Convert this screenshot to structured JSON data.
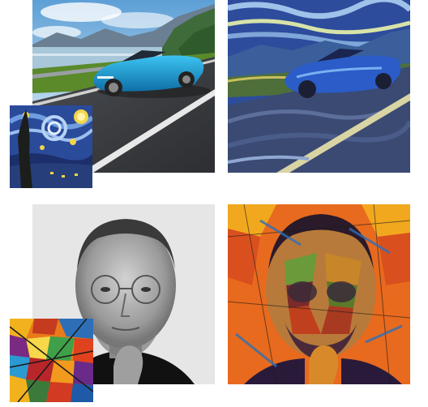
{
  "figure": {
    "rows": [
      {
        "content_image": "car-photo",
        "style_image": "starry-night-painting",
        "stylized_image": "car-stylized-starry-night"
      },
      {
        "content_image": "portrait-photo",
        "style_image": "abstract-mosaic-painting",
        "stylized_image": "portrait-stylized-mosaic"
      }
    ],
    "colors": {
      "car_body": "#1e9fd6",
      "sky": "#8ec3e8",
      "starry_blue": "#1f3f8f",
      "mosaic_orange": "#e87a1a",
      "mosaic_red": "#b8262a"
    }
  }
}
